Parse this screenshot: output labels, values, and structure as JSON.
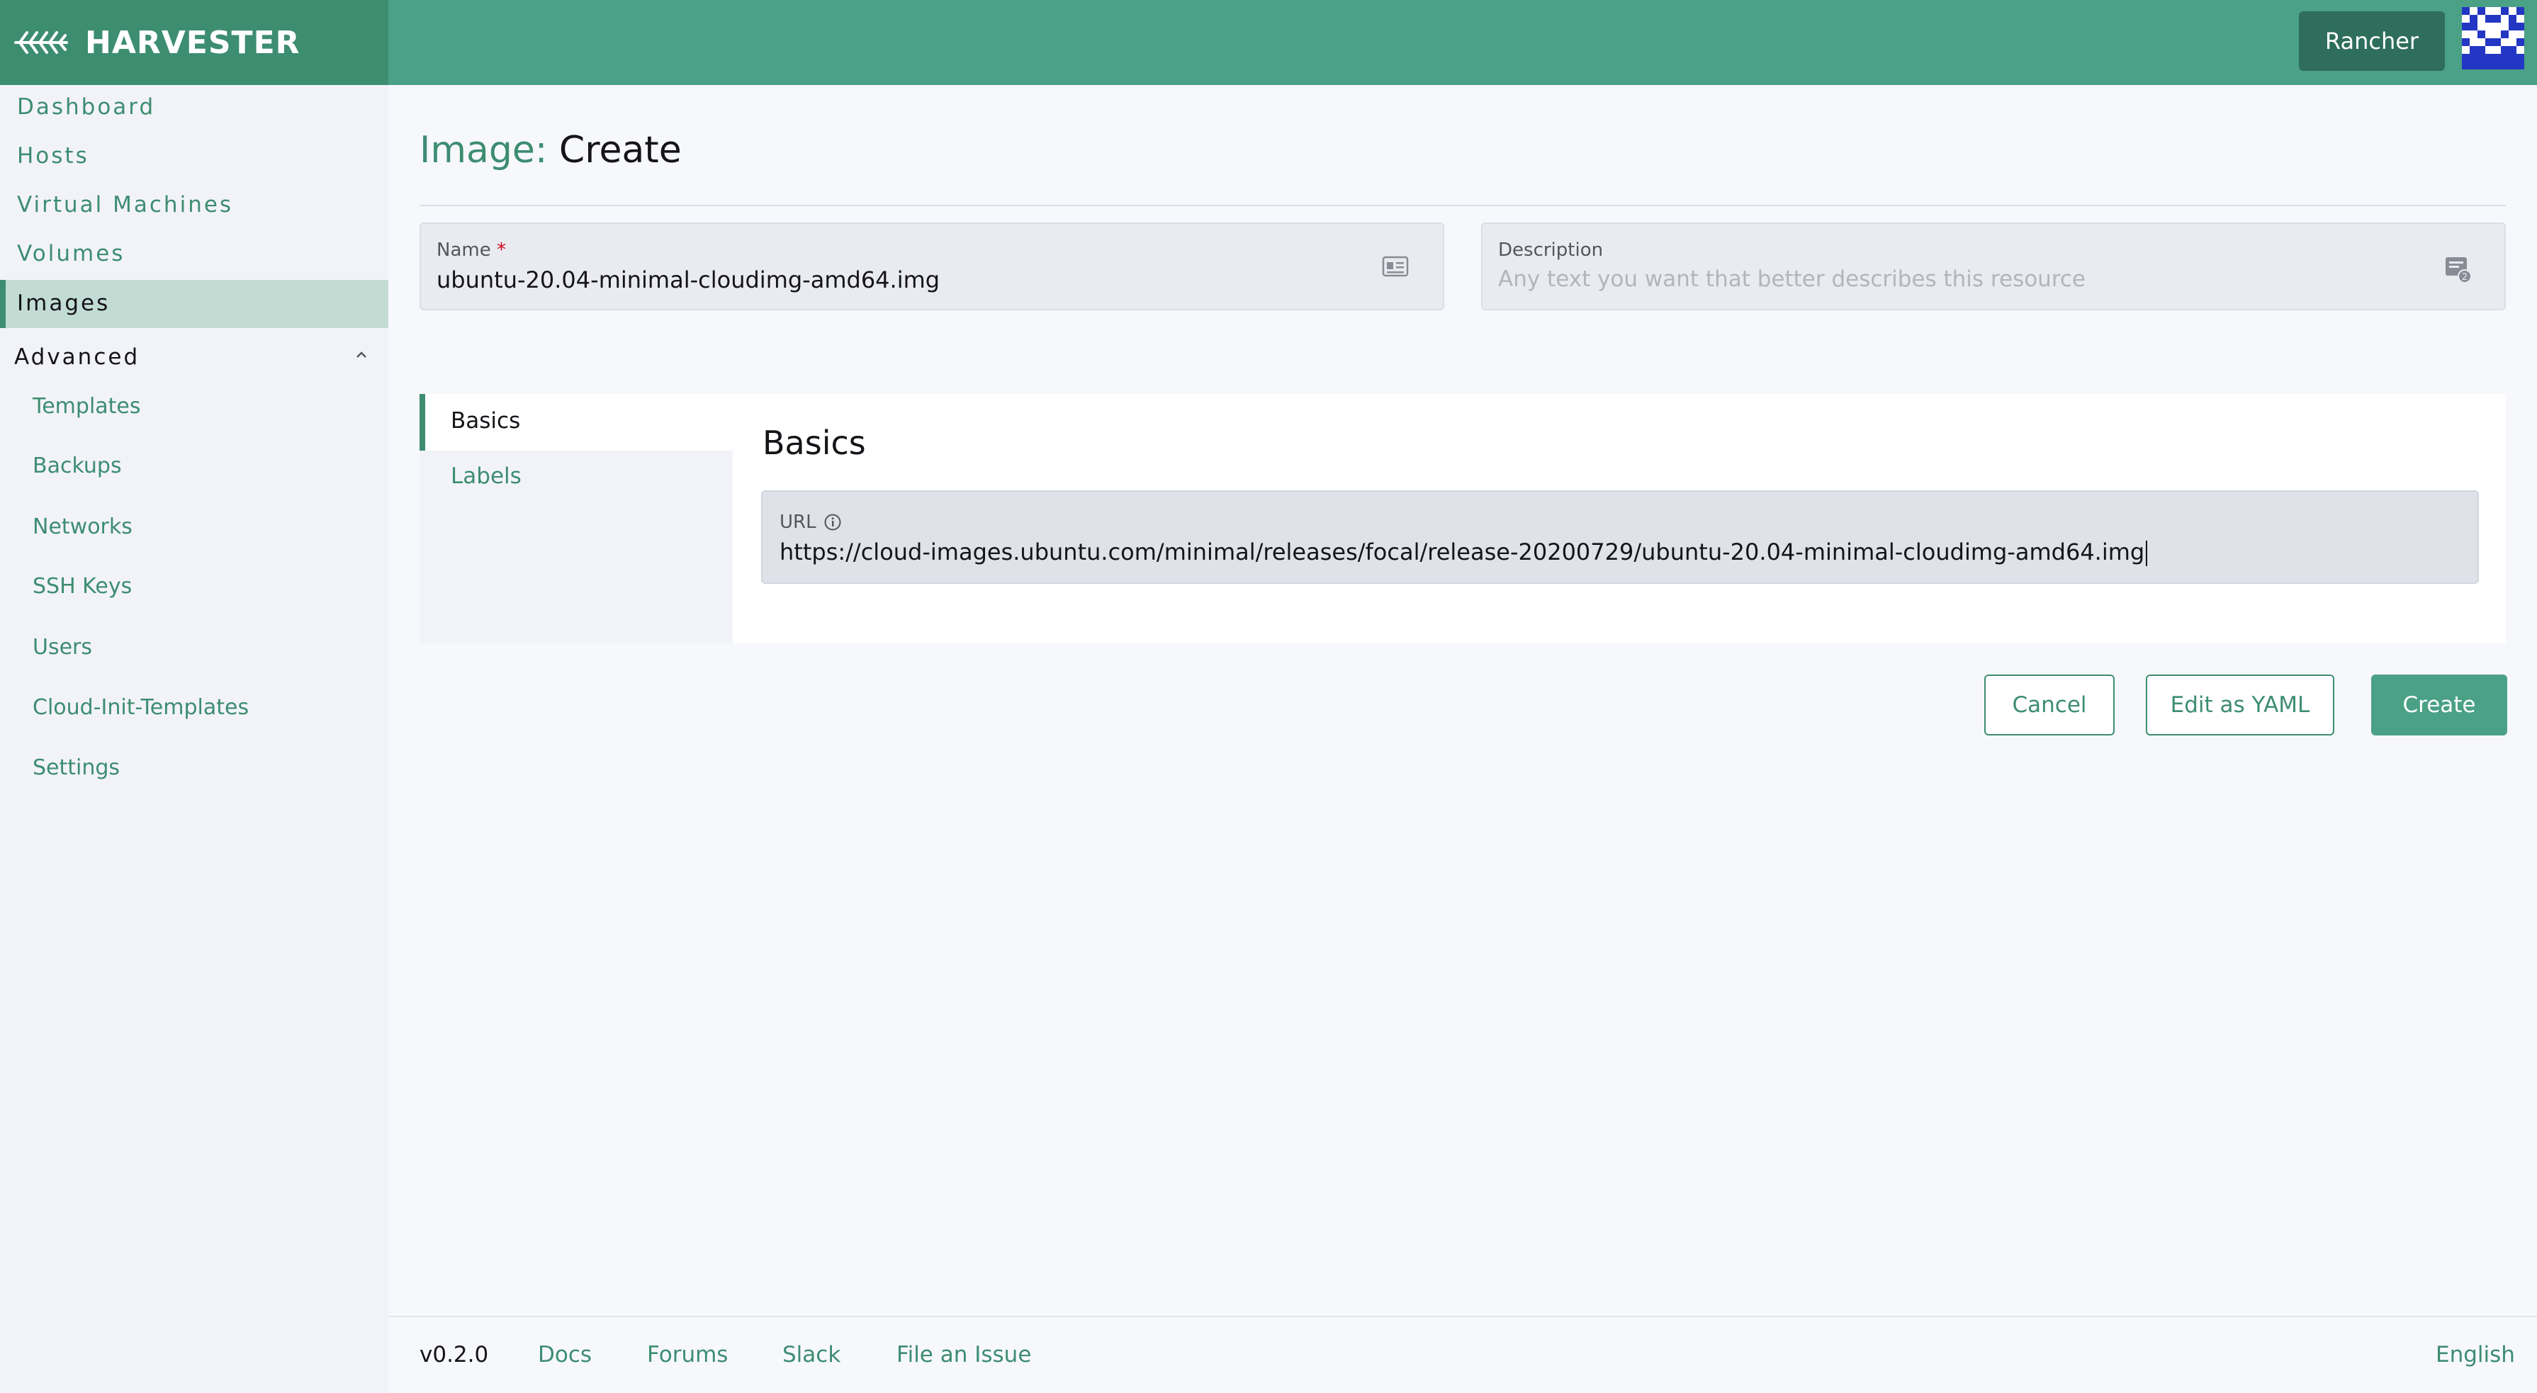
{
  "brand": {
    "name": "HARVESTER",
    "logo_icon": "harvester-logo-icon"
  },
  "header": {
    "rancher_button": "Rancher",
    "avatar_icon": "avatar-identicon"
  },
  "sidebar": {
    "items": [
      {
        "label": "Dashboard"
      },
      {
        "label": "Hosts"
      },
      {
        "label": "Virtual Machines"
      },
      {
        "label": "Volumes"
      },
      {
        "label": "Images",
        "active": true
      }
    ],
    "advanced": {
      "label": "Advanced",
      "expanded": true,
      "items": [
        {
          "label": "Templates"
        },
        {
          "label": "Backups"
        },
        {
          "label": "Networks"
        },
        {
          "label": "SSH Keys"
        },
        {
          "label": "Users"
        },
        {
          "label": "Cloud-Init-Templates"
        },
        {
          "label": "Settings"
        }
      ]
    }
  },
  "page": {
    "title_prefix": "Image:",
    "title": "Create"
  },
  "form": {
    "name": {
      "label": "Name",
      "required_mark": "*",
      "value": "ubuntu-20.04-minimal-cloudimg-amd64.img"
    },
    "description": {
      "label": "Description",
      "placeholder": "Any text you want that better describes this resource",
      "value": ""
    }
  },
  "tabs": [
    {
      "label": "Basics",
      "active": true
    },
    {
      "label": "Labels",
      "active": false
    }
  ],
  "basics": {
    "title": "Basics",
    "url": {
      "label": "URL",
      "value": "https://cloud-images.ubuntu.com/minimal/releases/focal/release-20200729/ubuntu-20.04-minimal-cloudimg-amd64.img"
    }
  },
  "actions": {
    "cancel": "Cancel",
    "edit_yaml": "Edit as YAML",
    "create": "Create"
  },
  "footer": {
    "version": "v0.2.0",
    "links": [
      "Docs",
      "Forums",
      "Slack",
      "File an Issue"
    ],
    "language": "English"
  },
  "colors": {
    "primary": "#4aa186",
    "primary_dark": "#3d8d71",
    "sidebar_bg": "#f2f3f8",
    "active_bg": "#c2dcd4"
  }
}
